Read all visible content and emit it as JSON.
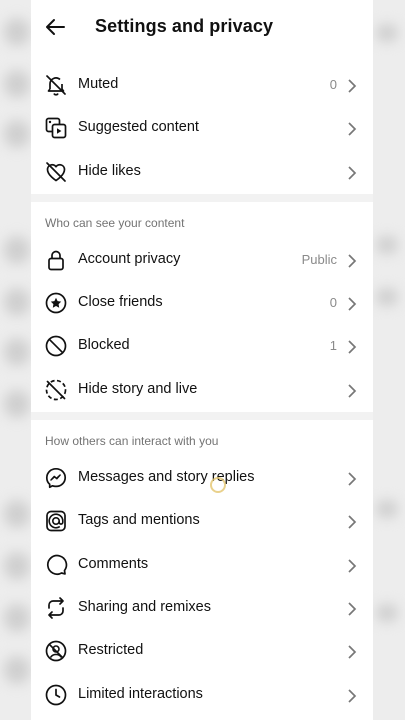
{
  "header": {
    "title": "Settings and privacy"
  },
  "rows_top": [
    {
      "id": "muted",
      "label": "Muted",
      "value": "0",
      "icon": "muted-bell-icon"
    },
    {
      "id": "suggested",
      "label": "Suggested content",
      "value": "",
      "icon": "suggested-content-icon"
    },
    {
      "id": "hidelikes",
      "label": "Hide likes",
      "value": "",
      "icon": "hide-likes-icon"
    }
  ],
  "section1": {
    "title": "Who can see your content",
    "rows": [
      {
        "id": "account-privacy",
        "label": "Account privacy",
        "value": "Public",
        "icon": "lock-icon"
      },
      {
        "id": "close-friends",
        "label": "Close friends",
        "value": "0",
        "icon": "star-circle-icon"
      },
      {
        "id": "blocked",
        "label": "Blocked",
        "value": "1",
        "icon": "blocked-icon"
      },
      {
        "id": "hide-story",
        "label": "Hide story and live",
        "value": "",
        "icon": "hide-story-icon"
      }
    ]
  },
  "section2": {
    "title": "How others can interact with you",
    "rows": [
      {
        "id": "messages",
        "label": "Messages and story replies",
        "value": "",
        "icon": "messenger-icon"
      },
      {
        "id": "tags",
        "label": "Tags and mentions",
        "value": "",
        "icon": "at-sign-icon"
      },
      {
        "id": "comments",
        "label": "Comments",
        "value": "",
        "icon": "comment-icon"
      },
      {
        "id": "sharing",
        "label": "Sharing and remixes",
        "value": "",
        "icon": "sharing-icon"
      },
      {
        "id": "restricted",
        "label": "Restricted",
        "value": "",
        "icon": "restricted-icon"
      },
      {
        "id": "limited",
        "label": "Limited interactions",
        "value": "",
        "icon": "limited-interactions-icon"
      }
    ]
  }
}
